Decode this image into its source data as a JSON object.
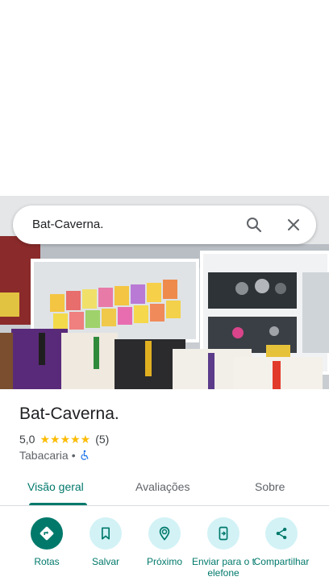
{
  "search": {
    "query": "Bat-Caverna."
  },
  "place": {
    "name": "Bat-Caverna.",
    "rating": "5,0",
    "stars": "★★★★★",
    "review_count": "(5)",
    "category": "Tabacaria",
    "separator": "•"
  },
  "tabs": [
    {
      "label": "Visão geral",
      "active": true
    },
    {
      "label": "Avaliações",
      "active": false
    },
    {
      "label": "Sobre",
      "active": false
    }
  ],
  "actions": [
    {
      "label": "Rotas",
      "icon": "directions-icon"
    },
    {
      "label": "Salvar",
      "icon": "bookmark-icon"
    },
    {
      "label": "Próximo",
      "icon": "nearby-icon"
    },
    {
      "label": "Enviar para o telefone",
      "icon": "send-to-phone-icon"
    },
    {
      "label": "Compartilhar",
      "icon": "share-icon"
    }
  ],
  "colors": {
    "accent": "#00796b",
    "action_bg": "#d2f2f6",
    "star": "#fbbc04"
  }
}
